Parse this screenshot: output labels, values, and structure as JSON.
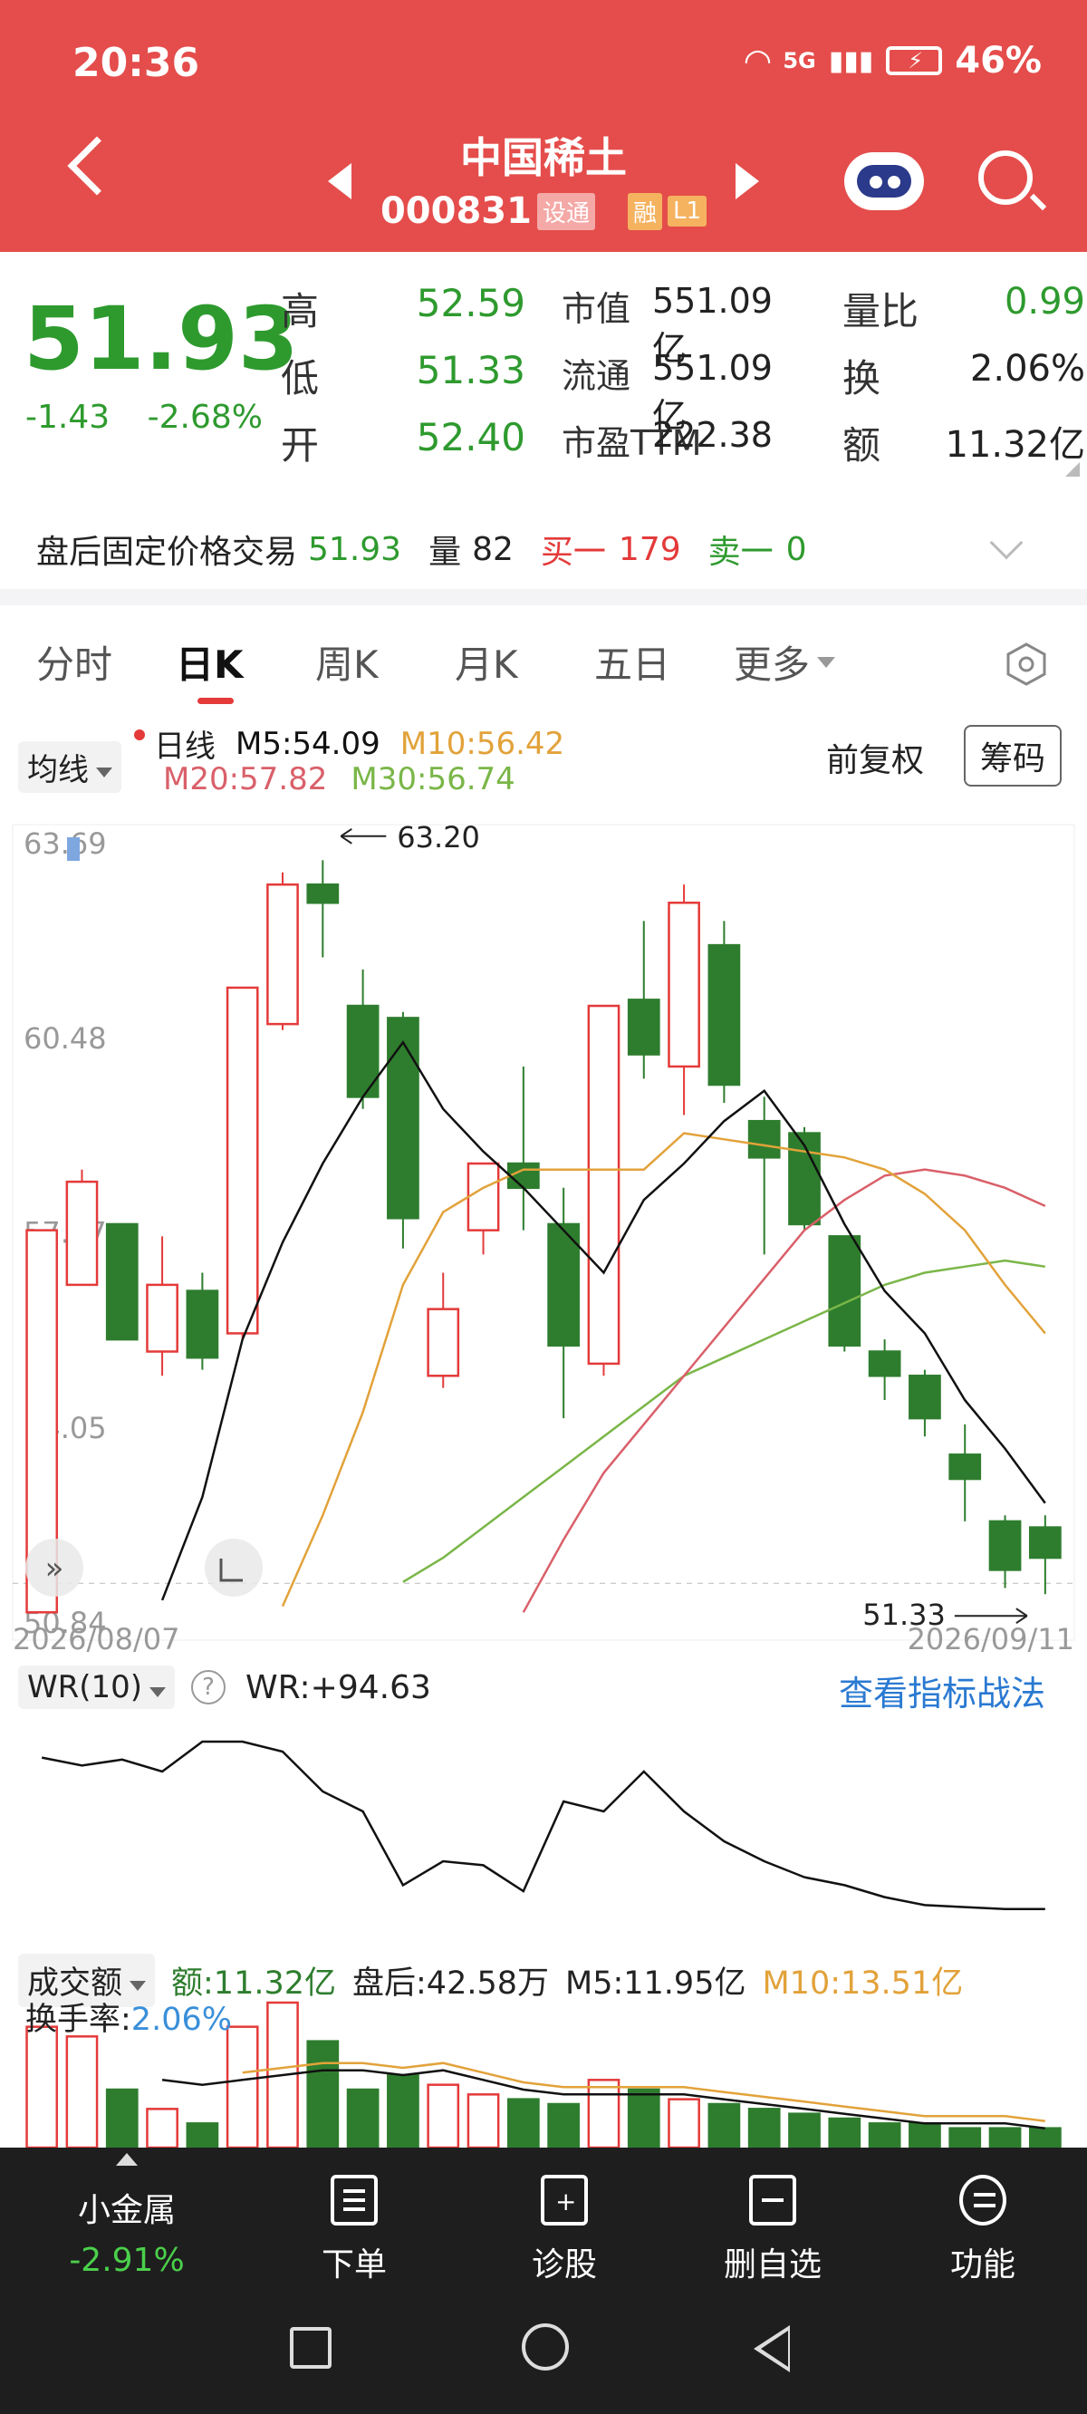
{
  "status": {
    "time": "20:36",
    "network": "5G",
    "battery": "46%"
  },
  "header": {
    "title": "中国稀土",
    "code": "000831",
    "tag_market": "设通",
    "tag_margin": "融",
    "tag_level": "L1"
  },
  "quote": {
    "price": "51.93",
    "change": "-1.43",
    "change_pct": "-2.68%",
    "rows": [
      {
        "l1": "高",
        "v1": "52.59",
        "l2": "市值",
        "v2": "551.09亿",
        "l3": "量比",
        "v3": "0.99"
      },
      {
        "l1": "低",
        "v1": "51.33",
        "l2": "流通",
        "v2": "551.09亿",
        "l3": "换",
        "v3": "2.06%"
      },
      {
        "l1": "开",
        "v1": "52.40",
        "l2": "市盈TTM",
        "v2": "222.38",
        "l3": "额",
        "v3": "11.32亿"
      }
    ]
  },
  "afterhours": {
    "label": "盘后固定价格交易",
    "price": "51.93",
    "vol_label": "量",
    "vol": "82",
    "buy_label": "买一",
    "buy": "179",
    "sell_label": "卖一",
    "sell": "0"
  },
  "tabs": [
    "分时",
    "日K",
    "周K",
    "月K",
    "五日",
    "更多"
  ],
  "active_tab": "日K",
  "kline": {
    "ma_selector": "均线",
    "period": "日线",
    "ma5": "M5:54.09",
    "ma10": "M10:56.42",
    "ma20": "M20:57.82",
    "ma30": "M30:56.74",
    "adjust": "前复权",
    "chip_button": "筹码",
    "high_marker": "63.20",
    "low_marker": "51.33",
    "start_date": "2026/08/07",
    "end_date": "2026/09/11"
  },
  "wr": {
    "selector": "WR(10)",
    "help": "?",
    "value": "WR:+94.63",
    "link": "查看指标战法"
  },
  "volume": {
    "selector": "成交额",
    "amount": "额:11.32亿",
    "after": "盘后:42.58万",
    "m5": "M5:11.95亿",
    "m10": "M10:13.51亿",
    "turnover_label": "换手率:",
    "turnover": "2.06%"
  },
  "bottom": {
    "sector": "小金属",
    "sector_pct": "-2.91%",
    "items": [
      "下单",
      "诊股",
      "删自选",
      "功能"
    ]
  },
  "colors": {
    "up": "#e43a3a",
    "down": "#2e7d2e",
    "ma5": "#111111",
    "ma10": "#e2a23a",
    "ma20": "#d9606a",
    "ma30": "#7ab648"
  },
  "chart_data": {
    "type": "candlestick",
    "y_ticks": [
      "63.69",
      "60.48",
      "57.27",
      "54.05",
      "50.84"
    ],
    "ylim": [
      50.84,
      63.69
    ],
    "x_range": [
      "2026/08/07",
      "2026/09/11"
    ],
    "candles": [
      {
        "o": 51.0,
        "c": 57.3,
        "h": 57.3,
        "l": 51.0
      },
      {
        "o": 56.4,
        "c": 58.1,
        "h": 58.3,
        "l": 56.4
      },
      {
        "o": 57.4,
        "c": 55.5,
        "h": 57.4,
        "l": 55.5
      },
      {
        "o": 55.3,
        "c": 56.4,
        "h": 57.2,
        "l": 54.9
      },
      {
        "o": 56.3,
        "c": 55.2,
        "h": 56.6,
        "l": 55.0
      },
      {
        "o": 55.6,
        "c": 61.3,
        "h": 61.3,
        "l": 55.5
      },
      {
        "o": 60.7,
        "c": 63.0,
        "h": 63.2,
        "l": 60.6
      },
      {
        "o": 63.0,
        "c": 62.7,
        "h": 63.4,
        "l": 61.8
      },
      {
        "o": 61.0,
        "c": 59.5,
        "h": 61.6,
        "l": 59.3
      },
      {
        "o": 60.8,
        "c": 57.5,
        "h": 60.9,
        "l": 57.0
      },
      {
        "o": 54.9,
        "c": 56.0,
        "h": 56.6,
        "l": 54.7
      },
      {
        "o": 57.3,
        "c": 58.4,
        "h": 58.4,
        "l": 56.9
      },
      {
        "o": 58.4,
        "c": 58.0,
        "h": 60.0,
        "l": 57.3
      },
      {
        "o": 57.4,
        "c": 55.4,
        "h": 58.0,
        "l": 54.2
      },
      {
        "o": 55.1,
        "c": 61.0,
        "h": 61.0,
        "l": 54.9
      },
      {
        "o": 61.1,
        "c": 60.2,
        "h": 62.4,
        "l": 59.8
      },
      {
        "o": 60.0,
        "c": 62.7,
        "h": 63.0,
        "l": 59.2
      },
      {
        "o": 62.0,
        "c": 59.7,
        "h": 62.4,
        "l": 59.4
      },
      {
        "o": 59.1,
        "c": 58.5,
        "h": 59.5,
        "l": 56.9
      },
      {
        "o": 58.9,
        "c": 57.4,
        "h": 59.0,
        "l": 57.3
      },
      {
        "o": 57.2,
        "c": 55.4,
        "h": 57.2,
        "l": 55.3
      },
      {
        "o": 55.3,
        "c": 54.9,
        "h": 55.5,
        "l": 54.5
      },
      {
        "o": 54.9,
        "c": 54.2,
        "h": 55.0,
        "l": 53.9
      },
      {
        "o": 53.6,
        "c": 53.2,
        "h": 54.1,
        "l": 52.5
      },
      {
        "o": 52.5,
        "c": 51.7,
        "h": 52.6,
        "l": 51.4
      },
      {
        "o": 52.4,
        "c": 51.9,
        "h": 52.6,
        "l": 51.3
      }
    ],
    "ma5": [
      null,
      null,
      null,
      51.2,
      52.9,
      55.5,
      57.1,
      58.4,
      59.5,
      60.4,
      59.3,
      58.6,
      58.0,
      57.3,
      56.6,
      57.8,
      58.4,
      59.1,
      59.6,
      58.7,
      57.4,
      56.3,
      55.6,
      54.5,
      53.7,
      52.8
    ],
    "ma10": [
      null,
      null,
      null,
      null,
      null,
      null,
      51.1,
      52.6,
      54.3,
      56.4,
      57.6,
      58.0,
      58.3,
      58.3,
      58.3,
      58.3,
      58.9,
      58.8,
      58.7,
      58.6,
      58.5,
      58.3,
      57.9,
      57.3,
      56.4,
      55.6
    ],
    "ma20": [
      null,
      null,
      null,
      null,
      null,
      null,
      null,
      null,
      null,
      null,
      null,
      null,
      51.0,
      52.2,
      53.3,
      54.1,
      54.9,
      55.7,
      56.5,
      57.3,
      57.8,
      58.2,
      58.3,
      58.2,
      58.0,
      57.7
    ],
    "ma30": [
      null,
      null,
      null,
      null,
      null,
      null,
      null,
      null,
      null,
      51.5,
      51.9,
      52.4,
      52.9,
      53.4,
      53.9,
      54.4,
      54.9,
      55.2,
      55.5,
      55.8,
      56.1,
      56.4,
      56.6,
      56.7,
      56.8,
      56.7
    ],
    "wr": [
      18,
      22,
      19,
      25,
      10,
      10,
      15,
      35,
      45,
      82,
      70,
      72,
      85,
      40,
      45,
      25,
      45,
      60,
      70,
      78,
      82,
      88,
      92,
      93,
      94,
      94
    ],
    "amount": [
      25,
      23,
      12,
      8,
      5,
      25,
      30,
      22,
      12,
      15,
      13,
      11,
      10,
      9,
      14,
      12,
      10,
      9,
      8,
      7,
      6,
      5,
      5,
      4,
      4,
      4
    ],
    "amount_ma5": [
      null,
      null,
      null,
      14,
      13,
      14,
      15,
      16,
      16,
      15,
      16,
      14,
      12,
      11,
      11,
      11,
      11,
      10,
      9,
      8,
      7,
      6,
      5,
      5,
      5,
      4
    ]
  }
}
